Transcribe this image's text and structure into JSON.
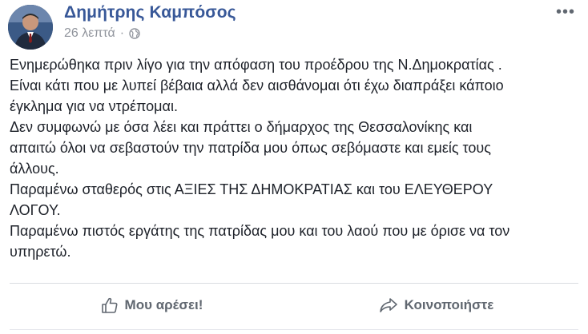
{
  "post": {
    "author": "Δημήτρης Καμπόσος",
    "timestamp": "26 λεπτά",
    "separator": "·",
    "privacy_icon": "globe-icon",
    "more_icon": "ellipsis-icon",
    "more_label": "•••",
    "body_lines": [
      "Ενημερώθηκα πριν λίγο για την απόφαση του προέδρου της Ν.Δημοκρατίας .",
      "Είναι κάτι που με λυπεί βέβαια αλλά δεν αισθάνομαι ότι έχω διαπράξει κάποιο",
      "έγκλημα για να ντρέπομαι.",
      "Δεν συμφωνώ με όσα λέει και πράττει ο δήμαρχος της Θεσσαλονίκης και",
      "απαιτώ όλοι να σεβαστούν την πατρίδα μου όπως σεβόμαστε και εμείς τους",
      "άλλους.",
      "Παραμένω σταθερός στις ΑΞΙΕΣ ΤΗΣ ΔΗΜΟΚΡΑΤΙΑΣ και του ΕΛΕΥΘΕΡΟΥ",
      "ΛΟΓΟΥ.",
      "Παραμένω πιστός εργάτης της πατρίδας μου και του λαού που με όρισε να τον",
      "υπηρετώ."
    ]
  },
  "actions": {
    "like_label": "Μου αρέσει!",
    "like_icon": "thumbs-up-icon",
    "share_label": "Κοινοποιήστε",
    "share_icon": "share-arrow-icon"
  },
  "colors": {
    "author_link": "#385898",
    "meta_gray": "#90949c",
    "body_text": "#1d2129",
    "action_gray": "#606770"
  }
}
